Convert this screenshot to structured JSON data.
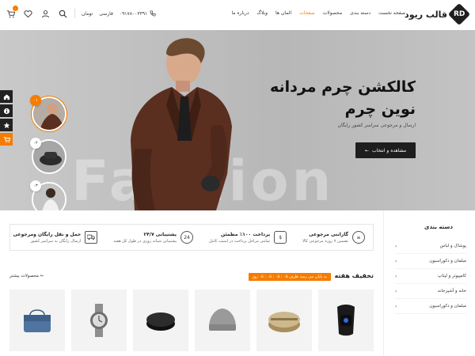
{
  "header": {
    "logo_mark": "RD",
    "logo_text": "قالب ریود",
    "nav": [
      {
        "label": "صفحه نخست",
        "active": false
      },
      {
        "label": "دسته بندی",
        "active": false
      },
      {
        "label": "محصولات",
        "active": false
      },
      {
        "label": "صفحات",
        "active": true
      },
      {
        "label": "المان ها",
        "active": false
      },
      {
        "label": "وبلاگ",
        "active": false
      },
      {
        "label": "درباره ما",
        "active": false
      }
    ],
    "phone": "۰۹۱۷۸۰۰۳۳۹۱",
    "language": "فارسی",
    "currency": "تومان",
    "cart_count": "۰",
    "wishlist_count": "۰"
  },
  "hero": {
    "title_line1": "کالکشن چرم مردانه",
    "title_line2": "نوین چرم",
    "subtitle": "ارسال و مرجوعی سراسر کشور رایگان",
    "button_label": "مشاهده و انتخاب",
    "watermark": "Fashion",
    "thumb_numbers": [
      "۰۱",
      "۰۲",
      "۰۳"
    ]
  },
  "features": [
    {
      "title": "گارانتی مرجوعی",
      "desc": "تضمین ۷ روزه مرجوعی کالا"
    },
    {
      "title": "پرداخت ۱۰۰٪ مطمئن",
      "desc": "تمامی مراحل پرداخت در امنیت کامل"
    },
    {
      "title": "پشتیبانی ۲۴/۷",
      "desc": "پشتیبانی شبانه روزی در طول کل هفته"
    },
    {
      "title": "حمل و نقل رایگان ومرجوعی",
      "desc": "ارسال رایگان به سراسر کشور"
    }
  ],
  "categories": {
    "title": "دسته بندی",
    "items": [
      "پوشاک و لباس",
      "مبلمان و دکوراسیون",
      "کامپیوتر و لپتاپ",
      "خانه و آشپزخانه",
      "مبلمان و دکوراسیون"
    ]
  },
  "deals": {
    "title": "تخفیف هفته",
    "timer": "به پایان می رسد ظرف ۰۵ : ۰۵ : ۰۵ : ۰۵ روز",
    "more_label": "محصولات بیشتر"
  },
  "colors": {
    "accent": "#f57c00",
    "dark": "#1e1e1e"
  }
}
